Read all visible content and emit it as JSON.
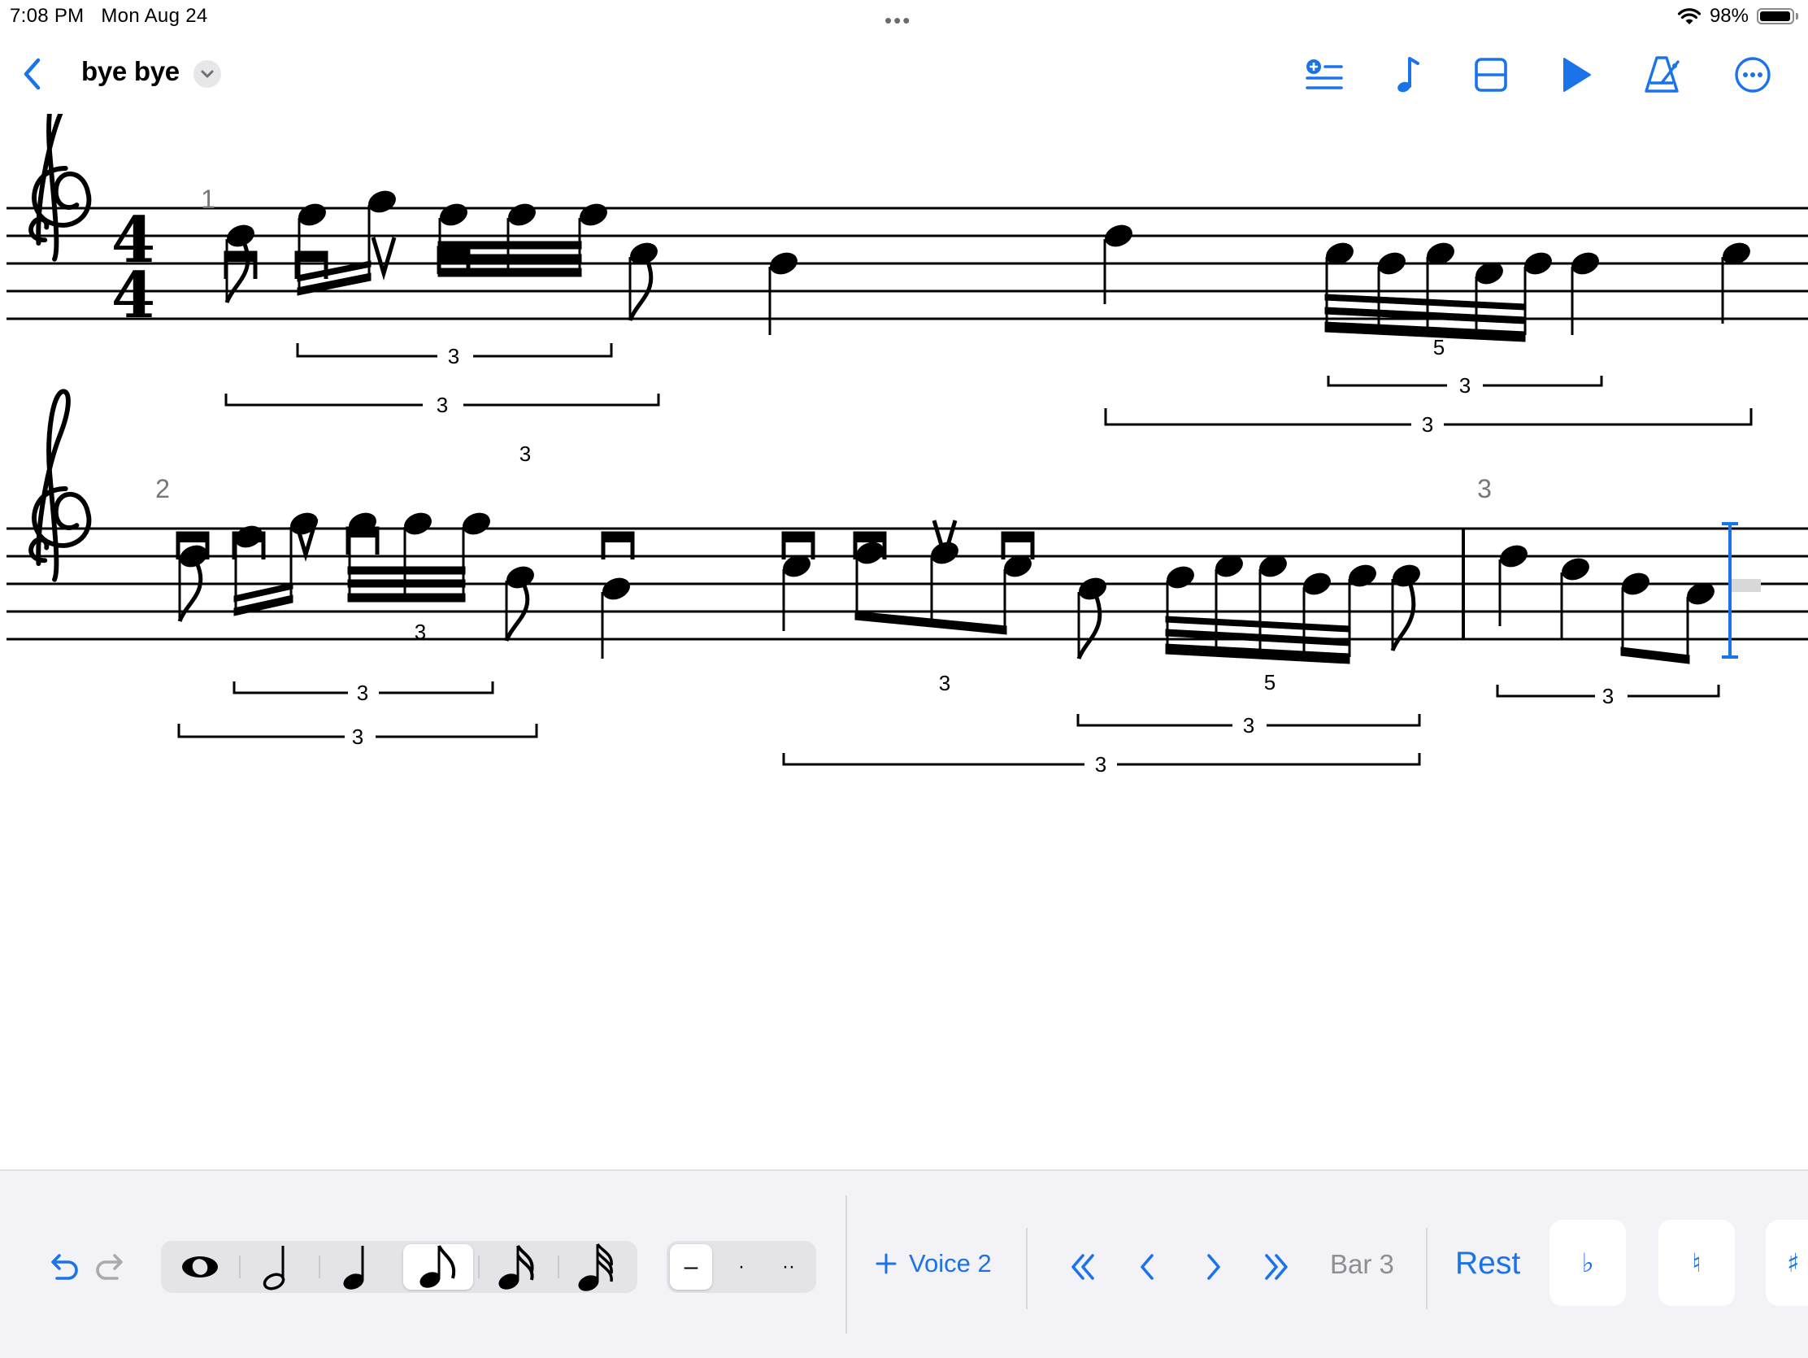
{
  "status_bar": {
    "time": "7:08 PM",
    "date": "Mon Aug 24",
    "battery_percent": "98%",
    "battery_level": 0.98,
    "more_dots": "•••"
  },
  "navbar": {
    "title": "bye bye",
    "icons": [
      "back-chevron-icon",
      "title-chevron-down-icon",
      "add-list-icon",
      "note-icon",
      "layout-icon",
      "play-icon",
      "metronome-icon",
      "more-options-icon"
    ],
    "accent": "#1a73e8"
  },
  "score": {
    "time_signature": {
      "top": "4",
      "bottom": "4"
    },
    "bars": [
      {
        "number": "1"
      },
      {
        "number": "2"
      },
      {
        "number": "3"
      }
    ],
    "tuplets": {
      "row1": [
        "3",
        "3",
        "3",
        "5",
        "3",
        "3"
      ],
      "row2": [
        "3",
        "3",
        "3",
        "3",
        "5",
        "3",
        "3",
        "3"
      ]
    }
  },
  "bottom_toolbar": {
    "voice_label": "Voice 2",
    "bar_label": "Bar 3",
    "rest_label": "Rest",
    "accidentals": [
      "♭",
      "♮",
      "♯"
    ],
    "durations": [
      "whole",
      "half",
      "quarter",
      "eighth",
      "sixteenth",
      "thirty-second"
    ],
    "selected_duration": "eighth",
    "dots": [
      "–",
      "·",
      "··"
    ],
    "selected_dot": "–",
    "accent": "#1a73e8"
  }
}
